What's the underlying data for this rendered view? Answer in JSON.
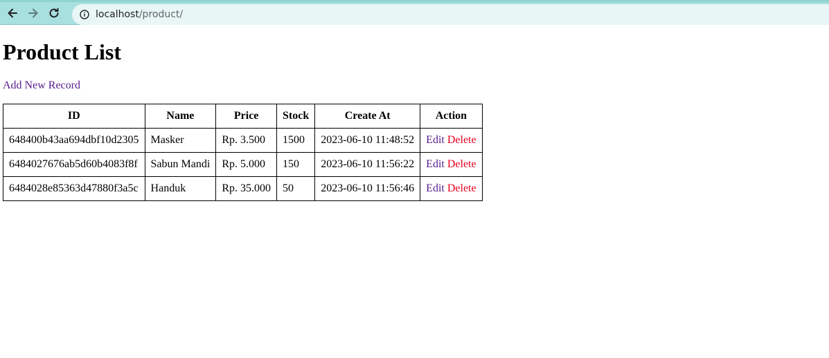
{
  "browser": {
    "url_host": "localhost",
    "url_path": "/product/"
  },
  "page": {
    "title": "Product List",
    "add_link": "Add New Record"
  },
  "table": {
    "headers": [
      "ID",
      "Name",
      "Price",
      "Stock",
      "Create At",
      "Action"
    ],
    "rows": [
      {
        "id": "648400b43aa694dbf10d2305",
        "name": "Masker",
        "price": "Rp. 3.500",
        "stock": "1500",
        "created": "2023-06-10 11:48:52",
        "edit": "Edit",
        "delete": "Delete"
      },
      {
        "id": "6484027676ab5d60b4083f8f",
        "name": "Sabun Mandi",
        "price": "Rp. 5.000",
        "stock": "150",
        "created": "2023-06-10 11:56:22",
        "edit": "Edit",
        "delete": "Delete"
      },
      {
        "id": "6484028e85363d47880f3a5c",
        "name": "Handuk",
        "price": "Rp. 35.000",
        "stock": "50",
        "created": "2023-06-10 11:56:46",
        "edit": "Edit",
        "delete": "Delete"
      }
    ]
  },
  "colors": {
    "visited_link": "#551a8b",
    "delete_link": "#e8001c",
    "toolbar": "#a8dfdf"
  }
}
